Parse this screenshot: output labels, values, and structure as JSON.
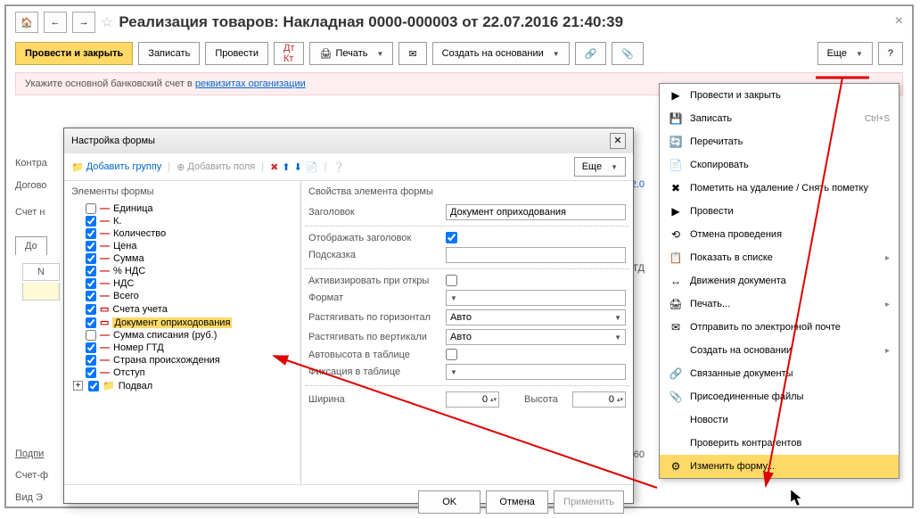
{
  "header": {
    "title": "Реализация товаров: Накладная 0000-000003 от 22.07.2016 21:40:39"
  },
  "toolbar": {
    "post_close": "Провести и закрыть",
    "save": "Записать",
    "post": "Провести",
    "print": "Печать",
    "create_based": "Создать на основании",
    "more": "Еще"
  },
  "warning": {
    "prefix": "Укажите основной банковский счет в ",
    "link": "реквизитах организации"
  },
  "bg": {
    "counterparty_label": "Контра",
    "contract_label": "Догово",
    "account_label": "Счет н",
    "tab_do": "До",
    "tab_n": "N",
    "sign_label": "Подпи",
    "invoice_label": "Счет-ф",
    "type_label": "Вид Э",
    "phone_partial": "1, 62.0",
    "gtd": "ТД",
    "qty": "60",
    "amount": ""
  },
  "dialog": {
    "title": "Настройка формы",
    "add_group": "Добавить группу",
    "add_fields": "Добавить поля",
    "more": "Еще",
    "left_title": "Элементы формы",
    "right_title": "Свойства элемента формы",
    "tree": [
      {
        "chk": false,
        "label": "Единица",
        "dash": true
      },
      {
        "chk": true,
        "label": "К.",
        "dash": true
      },
      {
        "chk": true,
        "label": "Количество",
        "dash": true
      },
      {
        "chk": true,
        "label": "Цена",
        "dash": true
      },
      {
        "chk": true,
        "label": "Сумма",
        "dash": true
      },
      {
        "chk": true,
        "label": "% НДС",
        "dash": true
      },
      {
        "chk": true,
        "label": "НДС",
        "dash": true
      },
      {
        "chk": true,
        "label": "Всего",
        "dash": true
      },
      {
        "chk": true,
        "label": "Счета учета",
        "dash": false
      },
      {
        "chk": true,
        "label": "Документ оприходования",
        "dash": false,
        "hi": true
      },
      {
        "chk": false,
        "label": "Сумма списания (руб.)",
        "dash": true
      },
      {
        "chk": true,
        "label": "Номер ГТД",
        "dash": true
      },
      {
        "chk": true,
        "label": "Страна происхождения",
        "dash": true
      },
      {
        "chk": true,
        "label": "Отступ",
        "dash": true
      }
    ],
    "footer_item": "Подвал",
    "props": {
      "header_label": "Заголовок",
      "header_value": "Документ оприходования",
      "show_header": "Отображать заголовок",
      "tooltip": "Подсказка",
      "activate_on_open": "Активизировать при откры",
      "format": "Формат",
      "stretch_h": "Растягивать по горизонтал",
      "stretch_v": "Растягивать по вертикали",
      "auto_height": "Автовысота в таблице",
      "fix_in_table": "Фиксация в таблице",
      "width": "Ширина",
      "height": "Высота",
      "auto": "Авто",
      "zero": "0"
    },
    "ok": "OK",
    "cancel": "Отмена",
    "apply": "Применить"
  },
  "menu": {
    "items": [
      {
        "icon": "▶",
        "label": "Провести и закрыть"
      },
      {
        "icon": "💾",
        "label": "Записать",
        "shortcut": "Ctrl+S"
      },
      {
        "icon": "🔄",
        "label": "Перечитать"
      },
      {
        "icon": "📄",
        "label": "Скопировать"
      },
      {
        "icon": "✖",
        "label": "Пометить на удаление / Снять пометку"
      },
      {
        "icon": "▶",
        "label": "Провести"
      },
      {
        "icon": "⟲",
        "label": "Отмена проведения"
      },
      {
        "icon": "📋",
        "label": "Показать в списке",
        "drop": true
      },
      {
        "icon": "↔",
        "label": "Движения документа"
      },
      {
        "icon": "🖨",
        "label": "Печать...",
        "drop": true
      },
      {
        "icon": "✉",
        "label": "Отправить по электронной почте"
      },
      {
        "icon": " ",
        "label": "Создать на основании",
        "drop": true
      },
      {
        "icon": "🔗",
        "label": "Связанные документы"
      },
      {
        "icon": "📎",
        "label": "Присоединенные файлы"
      },
      {
        "icon": " ",
        "label": "Новости"
      },
      {
        "icon": " ",
        "label": "Проверить контрагентов"
      },
      {
        "icon": "⚙",
        "label": "Изменить форму...",
        "hi": true
      }
    ]
  }
}
